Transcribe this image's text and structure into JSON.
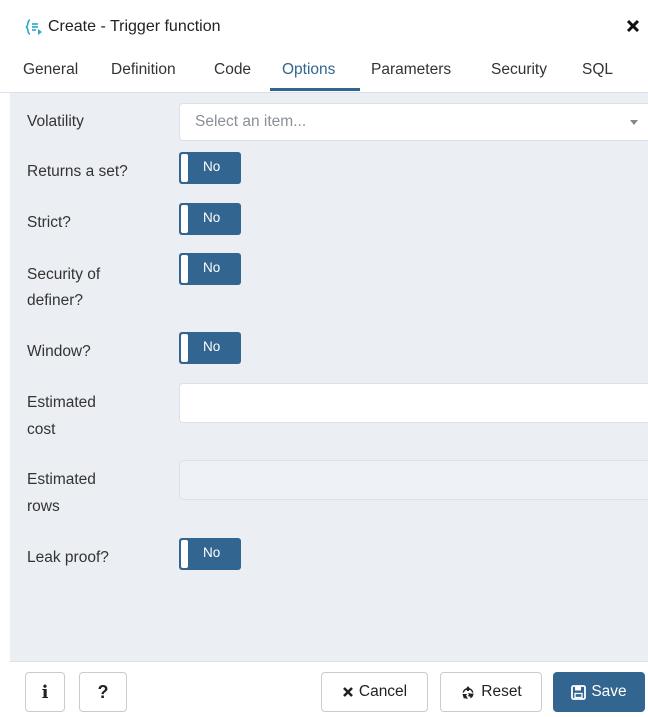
{
  "dialog": {
    "title": "Create - Trigger function",
    "icon": "trigger-function-icon"
  },
  "tabs": [
    {
      "label": "General",
      "active": false
    },
    {
      "label": "Definition",
      "active": false
    },
    {
      "label": "Code",
      "active": false
    },
    {
      "label": "Options",
      "active": true
    },
    {
      "label": "Parameters",
      "active": false
    },
    {
      "label": "Security",
      "active": false
    },
    {
      "label": "SQL",
      "active": false
    }
  ],
  "fields": {
    "volatility": {
      "label": "Volatility",
      "placeholder": "Select an item..."
    },
    "returns_set": {
      "label": "Returns a set?",
      "value": "No"
    },
    "strict": {
      "label": "Strict?",
      "value": "No"
    },
    "security_definer": {
      "label_line1": "Security of",
      "label_line2": "definer?",
      "value": "No"
    },
    "window": {
      "label": "Window?",
      "value": "No"
    },
    "estimated_cost": {
      "label_line1": "Estimated",
      "label_line2": "cost",
      "value": ""
    },
    "estimated_rows": {
      "label_line1": "Estimated",
      "label_line2": "rows",
      "value": "",
      "disabled": true
    },
    "leak_proof": {
      "label": "Leak proof?",
      "value": "No"
    }
  },
  "footer": {
    "info_label": "i",
    "help_label": "?",
    "cancel_label": "Cancel",
    "reset_label": "Reset",
    "save_label": "Save"
  },
  "colors": {
    "accent": "#326690",
    "body_bg": "#ebeef3",
    "border": "#dde0e6"
  }
}
